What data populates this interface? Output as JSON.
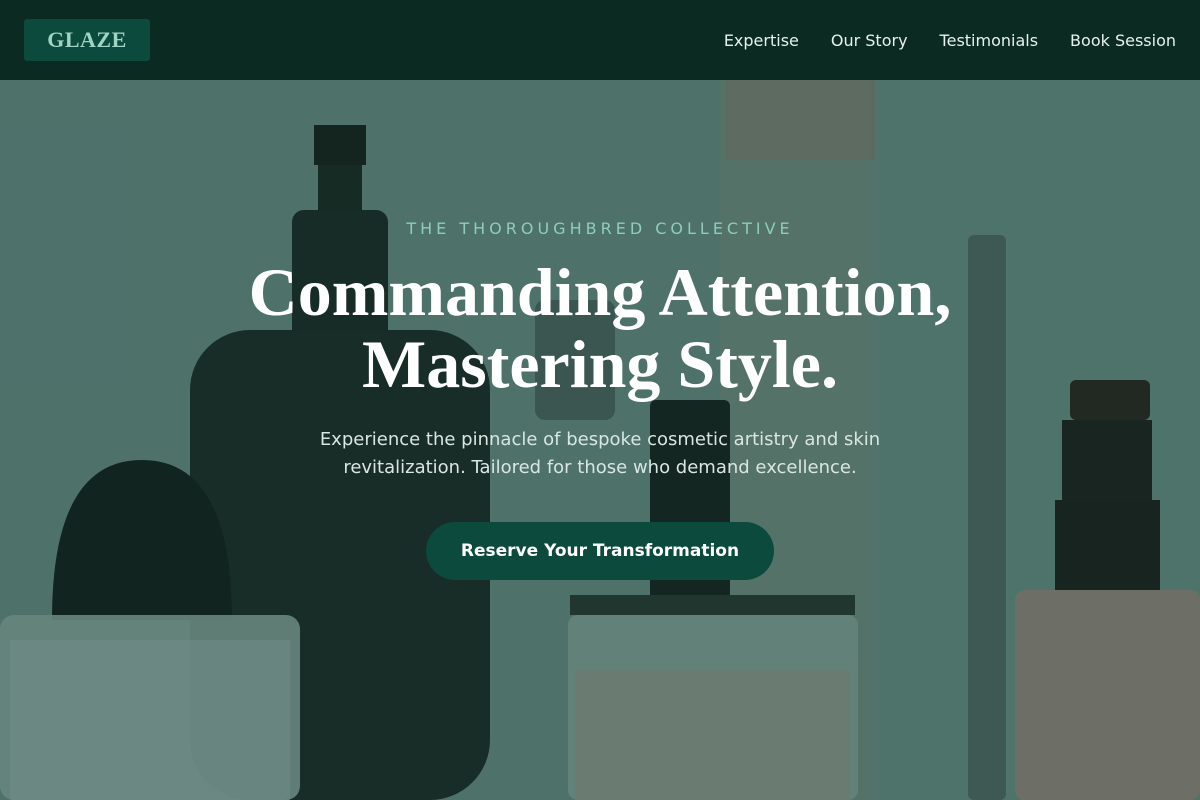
{
  "brand": {
    "logo_text": "GLAZE",
    "accent_color": "#0b4a3d",
    "nav_bg_color": "#0b2a22",
    "eyebrow_color": "#8fcdb9"
  },
  "nav": {
    "links": [
      {
        "label": "Expertise"
      },
      {
        "label": "Our Story"
      },
      {
        "label": "Testimonials"
      },
      {
        "label": "Book Session"
      }
    ]
  },
  "hero": {
    "eyebrow": "THE THOROUGHBRED COLLECTIVE",
    "headline_line1": "Commanding Attention,",
    "headline_line2": "Mastering Style.",
    "subtext": "Experience the pinnacle of bespoke cosmetic artistry and skin revitalization. Tailored for those who demand excellence.",
    "cta_label": "Reserve Your Transformation",
    "background_image": "cosmetic-bottles-photo"
  }
}
